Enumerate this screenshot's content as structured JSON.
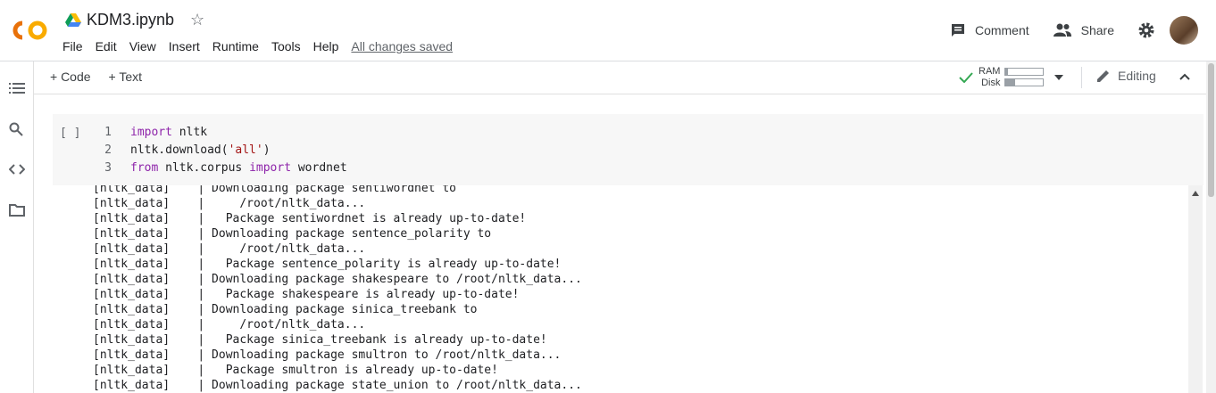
{
  "header": {
    "title": "KDM3.ipynb",
    "menu": [
      "File",
      "Edit",
      "View",
      "Insert",
      "Runtime",
      "Tools",
      "Help"
    ],
    "saved_status": "All changes saved",
    "comment_label": "Comment",
    "share_label": "Share"
  },
  "toolbar": {
    "add_code": "+ Code",
    "add_text": "+ Text",
    "ram_label": "RAM",
    "disk_label": "Disk",
    "ram_fraction": 0.05,
    "disk_fraction": 0.25,
    "editing_label": "Editing"
  },
  "cell": {
    "run_bracket": "[ ]",
    "lines": [
      {
        "num": "1",
        "parts": [
          {
            "t": "import",
            "c": "kw"
          },
          {
            "t": " nltk",
            "c": ""
          }
        ]
      },
      {
        "num": "2",
        "parts": [
          {
            "t": "nltk.download(",
            "c": ""
          },
          {
            "t": "'all'",
            "c": "str"
          },
          {
            "t": ")",
            "c": ""
          }
        ]
      },
      {
        "num": "3",
        "parts": [
          {
            "t": "from",
            "c": "kw"
          },
          {
            "t": " nltk.corpus ",
            "c": ""
          },
          {
            "t": "import",
            "c": "kw"
          },
          {
            "t": " wordnet",
            "c": ""
          }
        ]
      }
    ]
  },
  "output": [
    "[nltk_data]    | Downloading package sentiwordnet to",
    "[nltk_data]    |     /root/nltk_data...",
    "[nltk_data]    |   Package sentiwordnet is already up-to-date!",
    "[nltk_data]    | Downloading package sentence_polarity to",
    "[nltk_data]    |     /root/nltk_data...",
    "[nltk_data]    |   Package sentence_polarity is already up-to-date!",
    "[nltk_data]    | Downloading package shakespeare to /root/nltk_data...",
    "[nltk_data]    |   Package shakespeare is already up-to-date!",
    "[nltk_data]    | Downloading package sinica_treebank to",
    "[nltk_data]    |     /root/nltk_data...",
    "[nltk_data]    |   Package sinica_treebank is already up-to-date!",
    "[nltk_data]    | Downloading package smultron to /root/nltk_data...",
    "[nltk_data]    |   Package smultron is already up-to-date!",
    "[nltk_data]    | Downloading package state_union to /root/nltk_data..."
  ],
  "icons": [
    "colab-logo",
    "drive-icon",
    "star-icon",
    "comment-icon",
    "share-icon",
    "settings-icon",
    "avatar",
    "toc-icon",
    "search-icon",
    "code-snippets-icon",
    "files-icon",
    "check-icon",
    "dropdown-icon",
    "pencil-icon",
    "chevron-up-icon"
  ],
  "colors": {
    "logo_orange": "#f9ab00",
    "logo_dark": "#e8710a",
    "keyword": "#8e24aa",
    "string": "#a31515",
    "check_green": "#34a853"
  }
}
